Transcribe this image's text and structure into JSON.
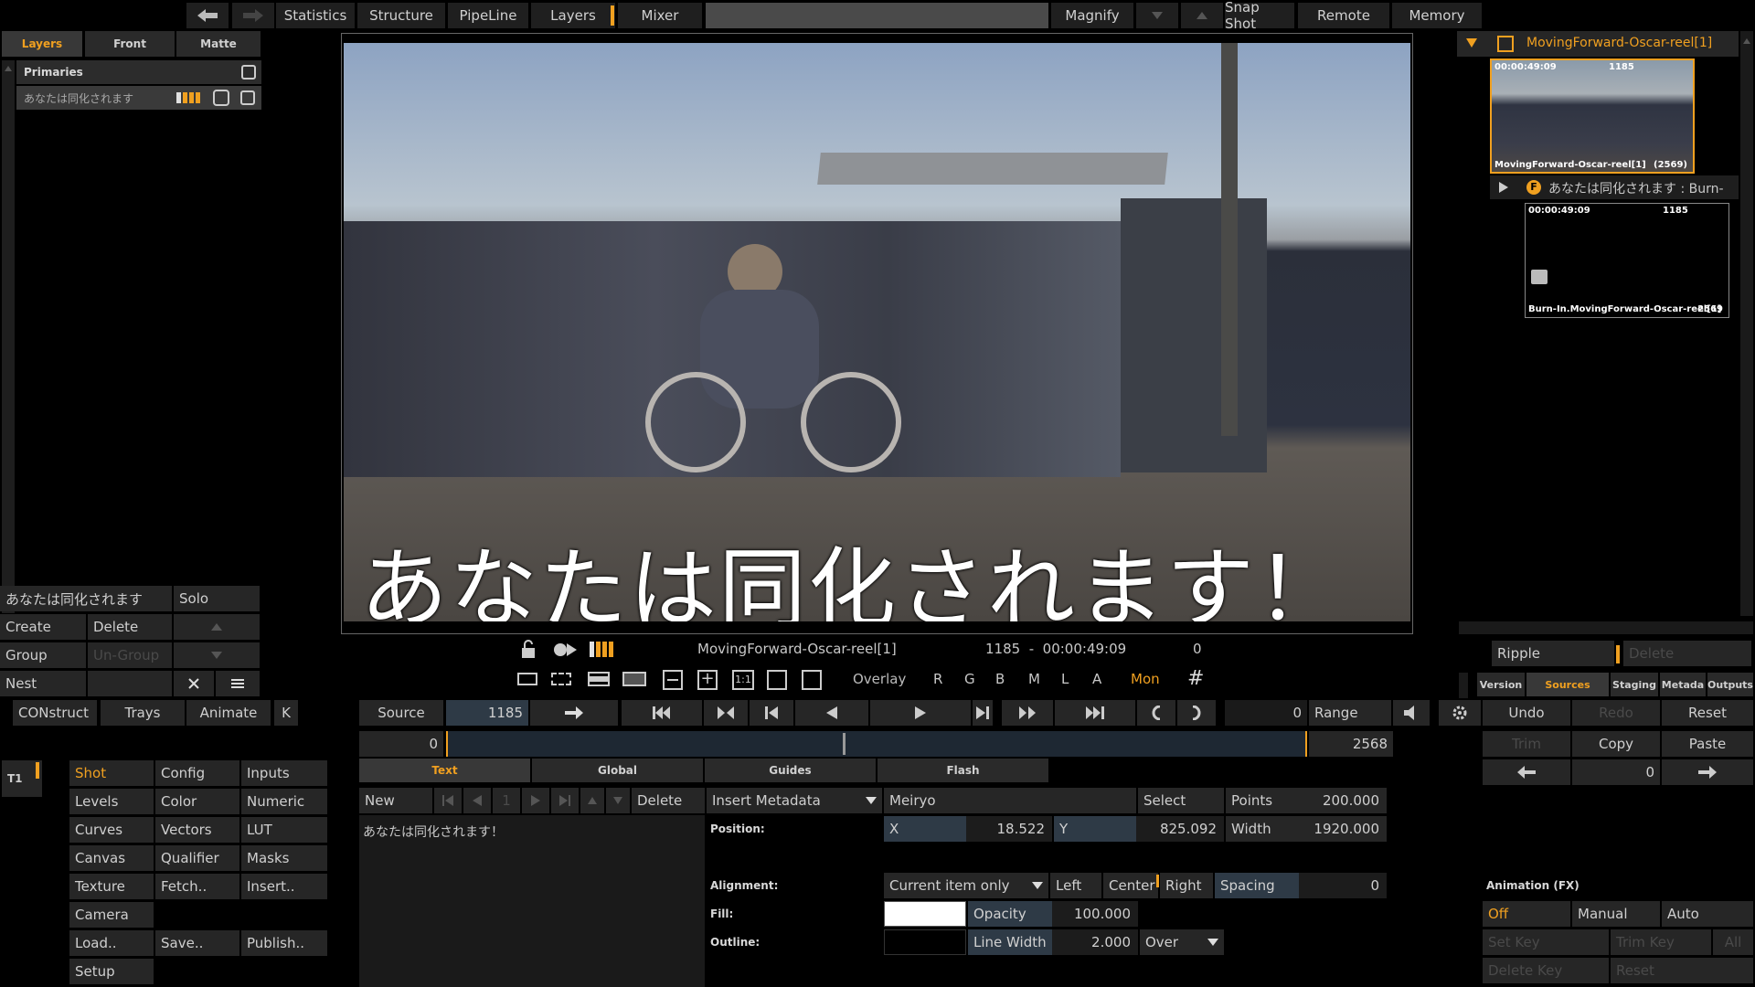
{
  "top_nav": {
    "items": [
      "Statistics",
      "Structure",
      "PipeLine",
      "Layers",
      "Mixer",
      "Magnify",
      "Snap Shot",
      "Remote",
      "Memory"
    ]
  },
  "left_panel": {
    "tabs": [
      "Layers",
      "Front",
      "Matte"
    ],
    "group_title": "Primaries",
    "layer_name": "あなたは同化されます",
    "bottom": {
      "layer_name": "あなたは同化されます",
      "solo": "Solo",
      "create": "Create",
      "delete": "Delete",
      "group": "Group",
      "ungroup": "Un-Group",
      "nest": "Nest"
    }
  },
  "viewer": {
    "subtitle": "あなたは同化されます！",
    "clip_name": "MovingForward-Oscar-reel[1]",
    "frame_timecode": "1185  -  00:00:49:09",
    "frame_offset": "0",
    "overlay": "Overlay",
    "channels": [
      "R",
      "G",
      "B",
      "M",
      "L",
      "A"
    ],
    "mon": "Mon"
  },
  "right_panel": {
    "reel_title": "MovingForward-Oscar-reel[1]",
    "thumb1": {
      "timecode": "00:00:49:09",
      "frame": "1185",
      "name": "MovingForward-Oscar-reel[1]",
      "count": "(2569)"
    },
    "sub_item": "あなたは同化されます : Burn-",
    "thumb2": {
      "timecode": "00:00:49:09",
      "frame": "1185",
      "name": "Burn-In.MovingForward-Oscar-reel[1]",
      "count": "2569"
    },
    "ripple": "Ripple",
    "delete": "Delete",
    "tabs": [
      "Version",
      "Sources",
      "Staging",
      "Metada",
      "Outputs"
    ]
  },
  "bottom_bar": {
    "construct": "CONstruct",
    "trays": "Trays",
    "animate": "Animate",
    "k": "K",
    "source": "Source",
    "frame": "1185",
    "frame_right": "0",
    "range": "Range",
    "undo": "Undo",
    "redo": "Redo",
    "reset": "Reset",
    "timeline_start": "0",
    "timeline_end": "2568",
    "trim": "Trim",
    "copy": "Copy",
    "paste": "Paste",
    "nudge_value": "0"
  },
  "tools": {
    "track": "T1",
    "buttons": [
      [
        "Shot",
        "Config",
        "Inputs"
      ],
      [
        "Levels",
        "Color",
        "Numeric"
      ],
      [
        "Curves",
        "Vectors",
        "LUT"
      ],
      [
        "Canvas",
        "Qualifier",
        "Masks"
      ],
      [
        "Texture",
        "Fetch..",
        "Insert.."
      ],
      [
        "Camera",
        "",
        ""
      ],
      [
        "Load..",
        "Save..",
        "Publish.."
      ],
      [
        "Setup",
        "",
        ""
      ]
    ]
  },
  "text_tool": {
    "tabs": [
      "Text",
      "Global",
      "Guides",
      "Flash"
    ],
    "new": "New",
    "index": "1",
    "delete": "Delete",
    "insert_metadata": "Insert Metadata",
    "font": "Meiryo",
    "select": "Select",
    "points_label": "Points",
    "points_value": "200.000",
    "text_content": "あなたは同化されます！",
    "position_label": "Position:",
    "x_label": "X",
    "x_value": "18.522",
    "y_label": "Y",
    "y_value": "825.092",
    "width_label": "Width",
    "width_value": "1920.000",
    "alignment_label": "Alignment:",
    "alignment_mode": "Current item only",
    "left": "Left",
    "center": "Center",
    "right": "Right",
    "spacing_label": "Spacing",
    "spacing_value": "0",
    "fill_label": "Fill:",
    "opacity_label": "Opacity",
    "opacity_value": "100.000",
    "outline_label": "Outline:",
    "line_width_label": "Line Width",
    "line_width_value": "2.000",
    "blend": "Over"
  },
  "animation": {
    "title": "Animation (FX)",
    "off": "Off",
    "manual": "Manual",
    "auto": "Auto",
    "set_key": "Set Key",
    "trim_key": "Trim Key",
    "all": "All",
    "delete_key": "Delete Key",
    "reset": "Reset"
  },
  "colors": {
    "accent": "#f0a020",
    "panel": "#262626",
    "field_blue": "#2e3a46"
  }
}
